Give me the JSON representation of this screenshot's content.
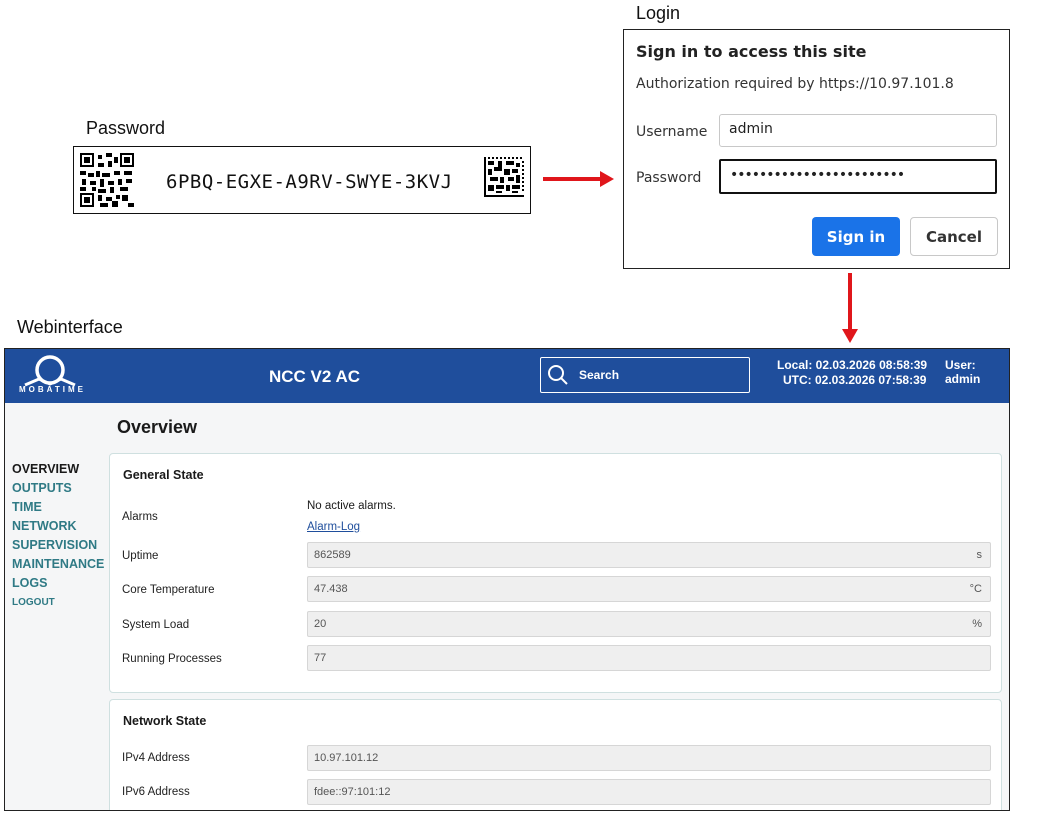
{
  "labels": {
    "password": "Password",
    "login": "Login",
    "webinterface": "Webinterface"
  },
  "password_label": {
    "code": "6PBQ-EGXE-A9RV-SWYE-3KVJ"
  },
  "login_dialog": {
    "title": "Sign in to access this site",
    "subtitle": "Authorization required by https://10.97.101.8",
    "username_label": "Username",
    "username_value": "admin",
    "password_label": "Password",
    "password_value": "••••••••••••••••••••••••",
    "sign_in": "Sign in",
    "cancel": "Cancel"
  },
  "header": {
    "logo_text": "MOBATIME",
    "device_title": "NCC V2 AC",
    "search_label": "Search",
    "local_time": "Local: 02.03.2026 08:58:39",
    "utc_time": "UTC: 02.03.2026 07:58:39",
    "user": "User: admin"
  },
  "nav": [
    "OVERVIEW",
    "OUTPUTS",
    "TIME",
    "NETWORK",
    "SUPERVISION",
    "MAINTENANCE",
    "LOGS",
    "LOGOUT"
  ],
  "overview": {
    "title": "Overview",
    "general_state": {
      "title": "General State",
      "alarms_label": "Alarms",
      "alarms_value": "No active alarms.",
      "alarm_log": "Alarm-Log",
      "uptime_label": "Uptime",
      "uptime_value": "862589",
      "uptime_unit": "s",
      "core_temp_label": "Core Temperature",
      "core_temp_value": "47.438",
      "core_temp_unit": "°C",
      "system_load_label": "System Load",
      "system_load_value": "20",
      "system_load_unit": "%",
      "processes_label": "Running Processes",
      "processes_value": "77"
    },
    "network_state": {
      "title": "Network State",
      "ipv4_label": "IPv4 Address",
      "ipv4_value": "10.97.101.12",
      "ipv6_label": "IPv6 Address",
      "ipv6_value": "fdee::97:101:12"
    }
  },
  "colors": {
    "header": "#1f4e9c",
    "accent_red": "#e0161b",
    "nav": "#2f7a85",
    "primary_button": "#1a73e8"
  }
}
